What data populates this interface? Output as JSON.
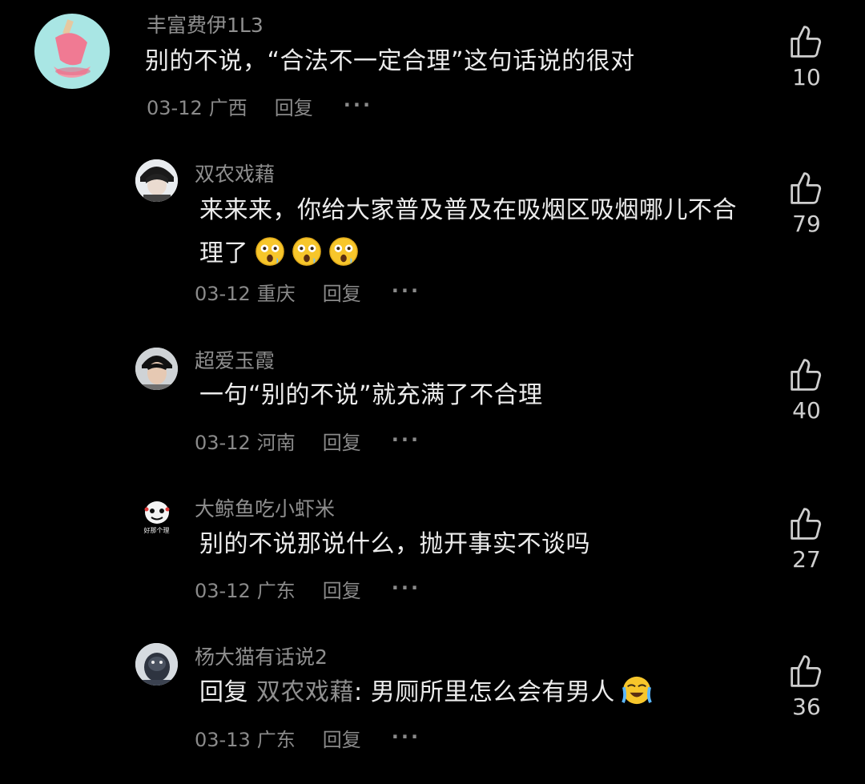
{
  "colors": {
    "background": "#000000",
    "primary_text": "#ececec",
    "secondary_text": "#8f8f8f",
    "like_icon": "#cfcfcf"
  },
  "comments": [
    {
      "username": "丰富费伊1L3",
      "text": "别的不说，“合法不一定合理”这句话说的很对",
      "date": "03-12",
      "location": "广西",
      "reply_label": "回复",
      "more_label": "···",
      "likes": "10",
      "like_icon": "thumbs-up-icon"
    },
    {
      "username": "双农戏藉",
      "text_line1": "来来来，你给大家普及普及在吸烟区吸烟哪儿不合",
      "text_line2": "理了",
      "emojis": [
        "astonished-face-emoji",
        "astonished-face-emoji",
        "astonished-face-emoji"
      ],
      "date": "03-12",
      "location": "重庆",
      "reply_label": "回复",
      "more_label": "···",
      "likes": "79",
      "like_icon": "thumbs-up-icon"
    },
    {
      "username": "超爱玉霞",
      "text": "一句“别的不说”就充满了不合理",
      "date": "03-12",
      "location": "河南",
      "reply_label": "回复",
      "more_label": "···",
      "likes": "40",
      "like_icon": "thumbs-up-icon"
    },
    {
      "username": "大鲸鱼吃小虾米",
      "text": "别的不说那说什么，抛开事实不谈吗",
      "avatar_caption": "好那个理",
      "date": "03-12",
      "location": "广东",
      "reply_label": "回复",
      "more_label": "···",
      "likes": "27",
      "like_icon": "thumbs-up-icon"
    },
    {
      "username": "杨大猫有话说2",
      "reply_prefix": "回复",
      "reply_target": "双农戏藉",
      "text": ": 男厕所里怎么会有男人",
      "emojis": [
        "loudly-crying-face-emoji"
      ],
      "date": "03-13",
      "location": "广东",
      "reply_label": "回复",
      "more_label": "···",
      "likes": "36",
      "like_icon": "thumbs-up-icon"
    }
  ]
}
